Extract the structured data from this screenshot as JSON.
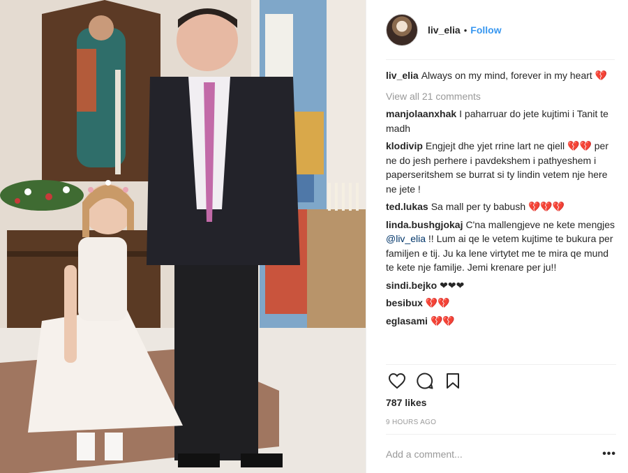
{
  "post": {
    "username": "liv_elia",
    "follow_label": "Follow",
    "separator": "•",
    "caption": {
      "user": "liv_elia",
      "text": "Always on my mind, forever in my heart 💔"
    },
    "view_all_label": "View all 21 comments",
    "comments": [
      {
        "user": "manjolaanxhak",
        "text": "I paharruar do jete kujtimi i Tanit te madh"
      },
      {
        "user": "klodivip",
        "text": "Engjejt dhe yjet rrine lart ne qiell 💔💔 per ne do jesh perhere i pavdekshem i pathyeshem i paperseritshem se burrat si ty lindin vetem nje here ne jete !"
      },
      {
        "user": "ted.lukas",
        "text": "Sa mall per ty babush 💔💔💔"
      },
      {
        "user": "linda.bushgjokaj",
        "text_before": "C'na mallengjeve ne kete mengjes",
        "mention": "@liv_elia",
        "text_after": "!! Lum ai qe le vetem kujtime te bukura per familjen e tij. Ju ka lene virtytet me te mira qe mund te kete nje familje. Jemi krenare per ju!!"
      },
      {
        "user": "sindi.bejko",
        "text": "❤❤❤"
      },
      {
        "user": "besibux",
        "text": "💔💔"
      },
      {
        "user": "eglasami",
        "text": "💔💔"
      }
    ],
    "likes": "787 likes",
    "time": "9 HOURS AGO",
    "add_comment_placeholder": "Add a comment...",
    "more_label": "•••",
    "icons": {
      "like": "heart-icon",
      "comment": "comment-bubble-icon",
      "save": "bookmark-icon"
    }
  }
}
